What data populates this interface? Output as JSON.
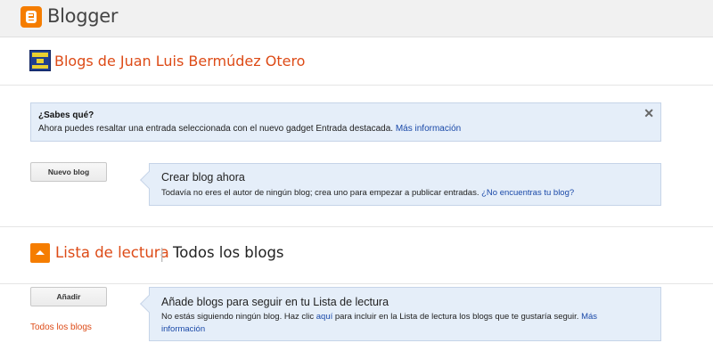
{
  "app": {
    "name": "Blogger"
  },
  "blog": {
    "title": "Blogs de Juan Luis Bermúdez Otero"
  },
  "tip": {
    "title": "¿Sabes qué?",
    "text": "Ahora puedes resaltar una entrada seleccionada con el nuevo gadget Entrada destacada.",
    "link": "Más información",
    "close": "✕"
  },
  "new_blog": {
    "button": "Nuevo blog",
    "callout_title": "Crear blog ahora",
    "callout_text": "Todavía no eres el autor de ningún blog; crea uno para empezar a publicar entradas.",
    "callout_link": "¿No encuentras tu blog?"
  },
  "reading_list": {
    "tab_reading": "Lista de lectura",
    "separator": "|",
    "tab_all": "Todos los blogs",
    "add_button": "Añadir",
    "side_link": "Todos los blogs",
    "callout_title": "Añade blogs para seguir en tu Lista de lectura",
    "callout_text_1": "No estás siguiendo ningún blog. Haz clic",
    "callout_link_1": "aquí",
    "callout_text_2": "para incluir en la Lista de lectura los blogs que te gustaría seguir.",
    "callout_link_2a": "Más",
    "callout_link_2b": "información"
  },
  "colors": {
    "accent": "#f57d00",
    "title": "#dd4b17",
    "link": "#1a49a8",
    "callout_bg": "#e5eef9"
  }
}
